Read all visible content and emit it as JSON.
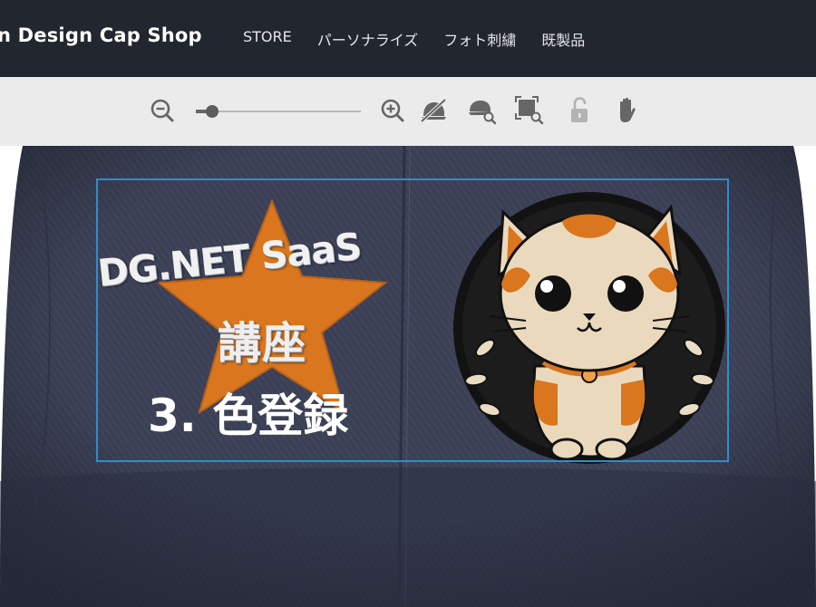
{
  "header": {
    "brand": "n Design Cap Shop",
    "nav": [
      "STORE",
      "パーソナライズ",
      "フォト刺繍",
      "既製品"
    ]
  },
  "toolbar": {
    "zoom_level": 0.1,
    "icons": [
      "zoom-out-icon",
      "zoom-in-icon",
      "hide-cap-icon",
      "cap-preview-icon",
      "crop-preview-icon",
      "unlock-icon",
      "hand-pan-icon"
    ]
  },
  "design": {
    "line1": "DG.NET SaaS",
    "line2": "講座",
    "line3": "3. 色登録"
  },
  "colors": {
    "header_bg": "#22262f",
    "toolbar_bg": "#ebebeb",
    "cap_navy": "#3a3f54",
    "frame_blue": "#2f8dcc",
    "star_orange": "#d9761e"
  }
}
